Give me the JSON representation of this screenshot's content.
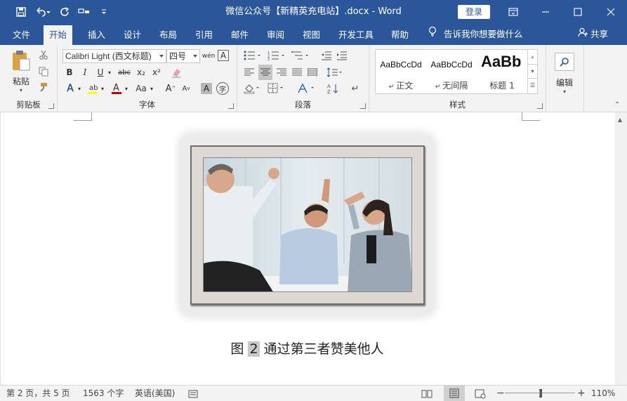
{
  "titlebar": {
    "document_title": "微信公众号【新精英充电站】.docx  -  Word",
    "login_label": "登录",
    "qat": [
      "save-icon",
      "undo-icon",
      "redo-icon",
      "touch-mode-icon",
      "customize-qat-icon"
    ]
  },
  "tabs": {
    "items": [
      "文件",
      "开始",
      "插入",
      "设计",
      "布局",
      "引用",
      "邮件",
      "审阅",
      "视图",
      "开发工具",
      "帮助"
    ],
    "active": "开始",
    "tell_me": "告诉我你想要做什么",
    "share": "共享"
  },
  "ribbon": {
    "clipboard": {
      "label": "剪贴板",
      "paste": "粘贴"
    },
    "font": {
      "label": "字体",
      "font_name": "Calibri Light (西文标题)",
      "font_size": "四号",
      "buttons": [
        "B",
        "I",
        "U",
        "abc",
        "x₂",
        "x²",
        "A",
        "Aa",
        "A",
        "A",
        "A"
      ]
    },
    "paragraph": {
      "label": "段落"
    },
    "styles": {
      "label": "样式",
      "items": [
        {
          "sample": "AaBbCcDd",
          "name": "正文"
        },
        {
          "sample": "AaBbCcDd",
          "name": "无间隔"
        },
        {
          "sample": "AaBb",
          "name": "标题 1"
        }
      ]
    },
    "editing": {
      "label": "编辑"
    }
  },
  "document": {
    "caption_prefix": "图",
    "caption_number": "2",
    "caption_text": "通过第三者赞美他人"
  },
  "status": {
    "page": "第 2 页，共 5 页",
    "words": "1563 个字",
    "language": "英语(美国)",
    "zoom": "110%",
    "zoom_level": 1.1
  },
  "colors": {
    "brand": "#2b579a",
    "ribbon_bg": "#f3f3f3",
    "highlight": "#ffff00",
    "font_color": "#c00000"
  }
}
